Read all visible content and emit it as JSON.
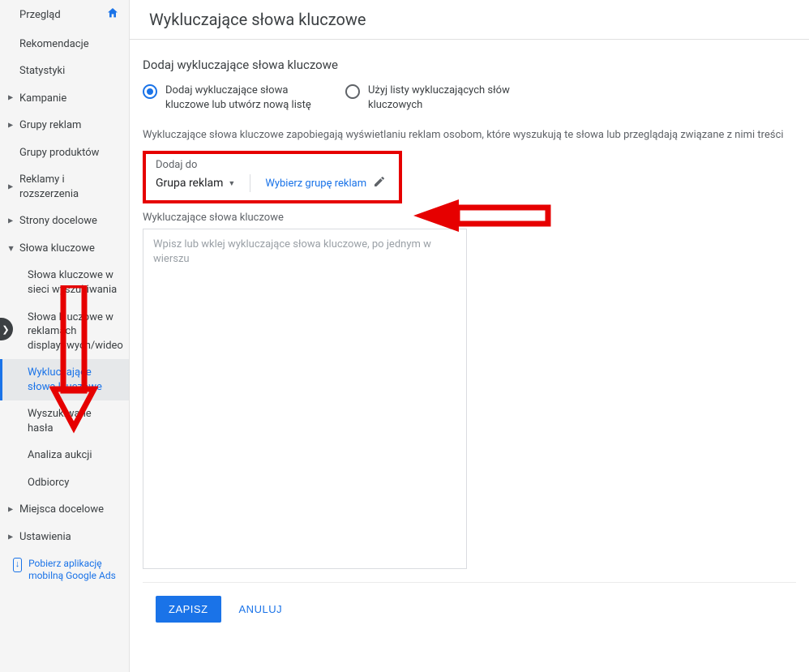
{
  "sidebar": {
    "overview": "Przegląd",
    "recommendations": "Rekomendacje",
    "stats": "Statystyki",
    "campaigns": "Kampanie",
    "adgroups": "Grupy reklam",
    "productgroups": "Grupy produktów",
    "ads_ext": "Reklamy i rozszerzenia",
    "landing": "Strony docelowe",
    "keywords": "Słowa kluczowe",
    "kw_search": "Słowa kluczowe w sieci wyszukiwania",
    "kw_display": "Słowa kluczowe w reklamach displayowych/wideo",
    "kw_negative": "Wykluczające słowa kluczowe",
    "search_terms": "Wyszukiwane hasła",
    "auction": "Analiza aukcji",
    "audiences": "Odbiorcy",
    "placements": "Miejsca docelowe",
    "settings": "Ustawienia",
    "app_link": "Pobierz aplikację mobilną Google Ads"
  },
  "page": {
    "title": "Wykluczające słowa kluczowe",
    "section_title": "Dodaj wykluczające słowa kluczowe",
    "radio_add": "Dodaj wykluczające słowa kluczowe lub utwórz nową listę",
    "radio_use_list": "Użyj listy wykluczających słów kluczowych",
    "info": "Wykluczające słowa kluczowe zapobiegają wyświetlaniu reklam osobom, które wyszukują te słowa lub przeglądają związane z nimi treści",
    "add_to_label": "Dodaj do",
    "scope_value": "Grupa reklam",
    "pick_group": "Wybierz grupę reklam",
    "kw_label": "Wykluczające słowa kluczowe",
    "kw_placeholder": "Wpisz lub wklej wykluczające słowa kluczowe, po jednym w wierszu",
    "save": "ZAPISZ",
    "cancel": "ANULUJ"
  }
}
